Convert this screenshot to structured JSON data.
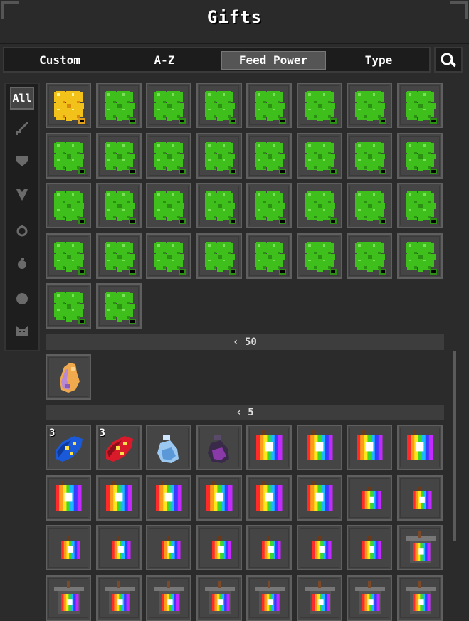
{
  "header": {
    "title": "Gifts"
  },
  "sort_tabs": [
    {
      "label": "Custom",
      "active": false
    },
    {
      "label": "A-Z",
      "active": false
    },
    {
      "label": "Feed Power",
      "active": true
    },
    {
      "label": "Type",
      "active": false
    }
  ],
  "search": {
    "icon": "magnifier-icon"
  },
  "filters": [
    {
      "label": "All",
      "icon": "all-text",
      "active": true
    },
    {
      "label": "",
      "icon": "sword-icon",
      "active": false
    },
    {
      "label": "",
      "icon": "armor-icon",
      "active": false
    },
    {
      "label": "",
      "icon": "amulet-icon",
      "active": false
    },
    {
      "label": "",
      "icon": "ring-icon",
      "active": false
    },
    {
      "label": "",
      "icon": "potion-icon",
      "active": false
    },
    {
      "label": "",
      "icon": "orb-icon",
      "active": false
    },
    {
      "label": "",
      "icon": "cat-icon",
      "active": false
    }
  ],
  "groups": [
    {
      "divider_label": "",
      "item_count": 34,
      "items": [
        "golden-clover",
        "clover",
        "clover",
        "clover",
        "clover",
        "clover",
        "clover",
        "clover",
        "clover",
        "clover",
        "clover",
        "clover",
        "clover",
        "clover",
        "clover",
        "clover",
        "clover",
        "clover",
        "clover",
        "clover",
        "clover",
        "clover",
        "clover",
        "clover",
        "clover",
        "clover",
        "clover",
        "clover",
        "clover",
        "clover",
        "clover",
        "clover",
        "clover",
        "clover"
      ]
    },
    {
      "divider_label": "‹ 50",
      "items": [
        "egg-gem"
      ]
    },
    {
      "divider_label": "‹ 5",
      "items": [
        {
          "icon": "blue-candy",
          "qty": "3"
        },
        {
          "icon": "red-candy",
          "qty": "3"
        },
        {
          "icon": "blue-potion"
        },
        {
          "icon": "purple-potion"
        },
        {
          "icon": "rainbow-paint-large"
        },
        {
          "icon": "rainbow-paint-large"
        },
        {
          "icon": "rainbow-paint-large"
        },
        {
          "icon": "rainbow-paint-large"
        },
        {
          "icon": "rainbow-paint-large"
        },
        {
          "icon": "rainbow-paint-large"
        },
        {
          "icon": "rainbow-paint-large"
        },
        {
          "icon": "rainbow-paint-large"
        },
        {
          "icon": "rainbow-paint-large"
        },
        {
          "icon": "rainbow-paint-large"
        },
        {
          "icon": "rainbow-paint-small"
        },
        {
          "icon": "rainbow-paint-small"
        },
        {
          "icon": "rainbow-paint-small"
        },
        {
          "icon": "rainbow-paint-small"
        },
        {
          "icon": "rainbow-paint-small"
        },
        {
          "icon": "rainbow-paint-small"
        },
        {
          "icon": "rainbow-paint-small"
        },
        {
          "icon": "rainbow-paint-small"
        },
        {
          "icon": "rainbow-paint-small"
        },
        {
          "icon": "rainbow-bucket"
        },
        {
          "icon": "rainbow-bucket"
        },
        {
          "icon": "rainbow-bucket"
        },
        {
          "icon": "rainbow-bucket"
        },
        {
          "icon": "rainbow-bucket"
        },
        {
          "icon": "rainbow-bucket"
        },
        {
          "icon": "rainbow-bucket"
        },
        {
          "icon": "rainbow-bucket"
        },
        {
          "icon": "rainbow-bucket"
        }
      ]
    }
  ],
  "colors": {
    "clover": "#3fbf1c",
    "golden_clover": "#f2c21a",
    "slot_bg": "#454545",
    "panel_bg": "#2b2b2b"
  }
}
